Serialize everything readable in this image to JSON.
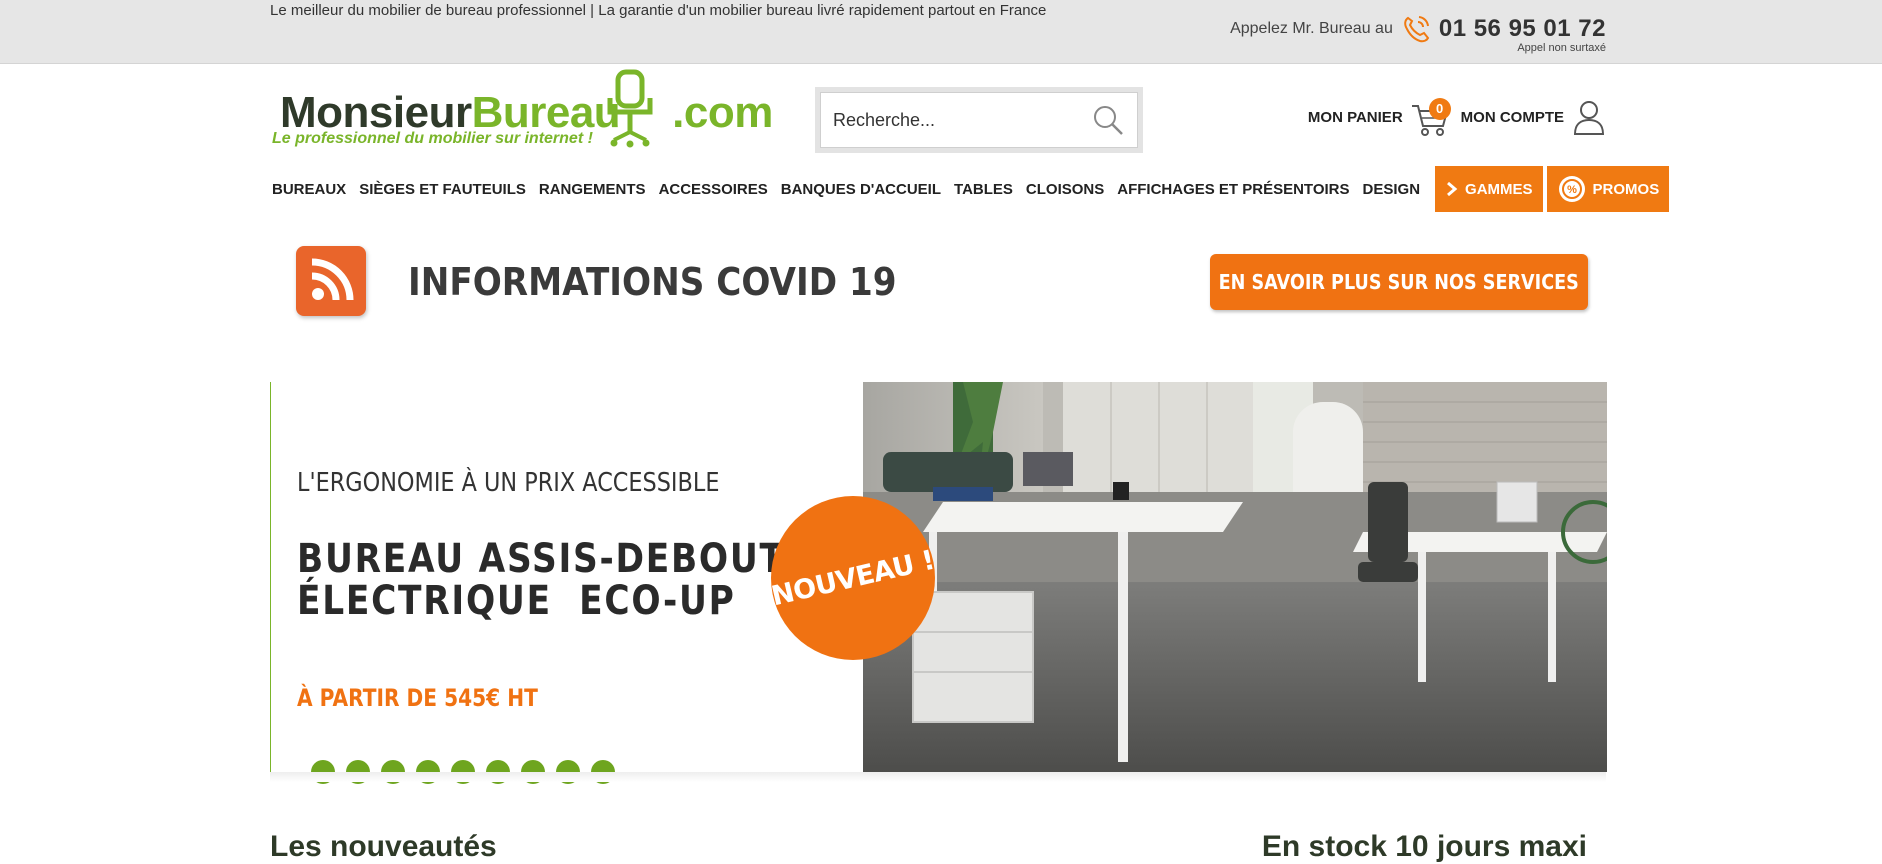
{
  "topbar": {
    "tagline": "Le meilleur du mobilier de bureau professionnel | La garantie d'un mobilier bureau livré rapidement partout en France",
    "call_label": "Appelez Mr. Bureau au",
    "phone": "01 56 95 01 72",
    "phone_note": "Appel non surtaxé"
  },
  "logo": {
    "part1": "Monsieur",
    "part2": "Bureau",
    "part3": ".com",
    "slogan": "Le professionnel du mobilier sur internet !"
  },
  "search": {
    "placeholder": "Recherche..."
  },
  "account": {
    "cart_label": "MON PANIER",
    "cart_count": "0",
    "account_label": "MON COMPTE"
  },
  "nav": {
    "items": [
      "BUREAUX",
      "SIÈGES ET FAUTEUILS",
      "RANGEMENTS",
      "ACCESSOIRES",
      "BANQUES D'ACCUEIL",
      "TABLES",
      "CLOISONS",
      "AFFICHAGES ET PRÉSENTOIRS",
      "DESIGN"
    ],
    "gammes": "GAMMES",
    "promos": "PROMOS"
  },
  "covid": {
    "title": "INFORMATIONS COVID 19",
    "button": "EN SAVOIR PLUS SUR NOS SERVICES"
  },
  "hero": {
    "kicker": "L'ERGONOMIE À UN PRIX ACCESSIBLE",
    "headline_line1": "BUREAU ASSIS-DEBOUT",
    "headline_line2": "ÉLECTRIQUE  ECO-UP",
    "price": "À PARTIR DE 545€ HT",
    "badge": "NOUVEAU !",
    "slides": 9
  },
  "sections": {
    "left": "Les nouveautés",
    "right": "En stock 10 jours maxi"
  },
  "colors": {
    "accent_orange": "#f07212",
    "brand_green": "#7ab52a",
    "dot_green": "#6ea51f"
  }
}
